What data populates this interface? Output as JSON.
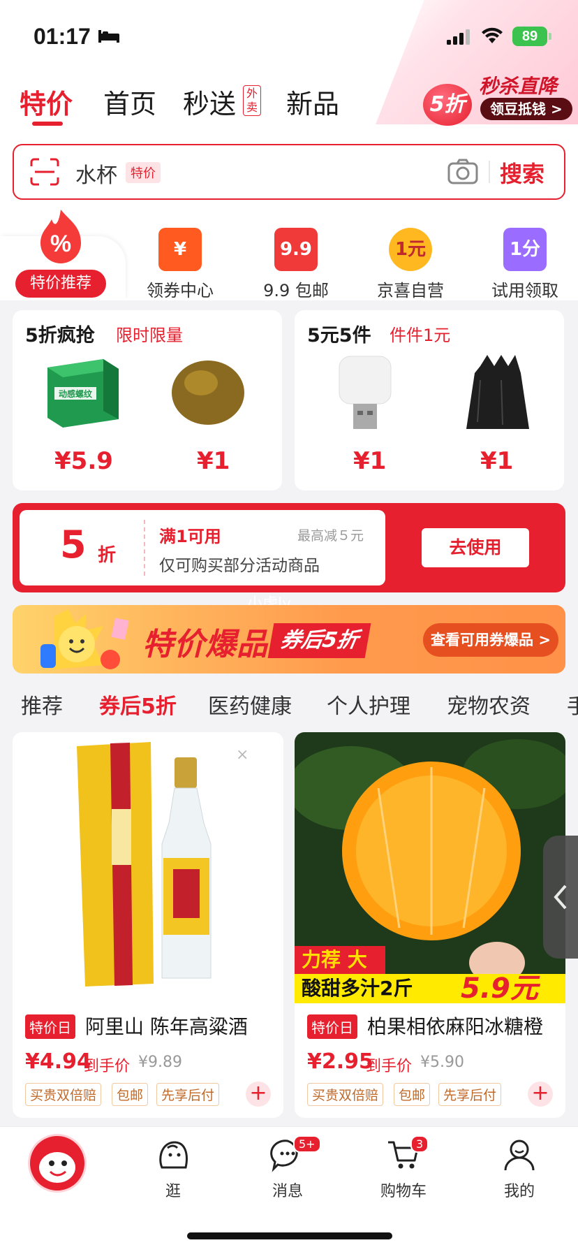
{
  "status": {
    "time": "01:17",
    "battery": "89"
  },
  "nav": {
    "tabs": [
      "特价",
      "首页",
      "秒送",
      "新品"
    ],
    "waimai": "外卖"
  },
  "flash": {
    "badge": "5折",
    "title": "秒杀直降",
    "button": "领豆抵钱 >"
  },
  "search": {
    "query": "水杯",
    "tag": "特价",
    "button": "搜索"
  },
  "categories": [
    {
      "label": "特价推荐",
      "icon": "fire-percent-icon",
      "active": true
    },
    {
      "label": "领券中心",
      "icon": "coupon-yen-icon",
      "glyph": "¥",
      "color": "#ff5a1f"
    },
    {
      "label": "9.9 包邮",
      "icon": "gift-box-icon",
      "glyph": "9.9",
      "color": "#f03a3a"
    },
    {
      "label": "京喜自营",
      "icon": "one-yuan-icon",
      "glyph": "1元",
      "color": "#ffb81f"
    },
    {
      "label": "试用领取",
      "icon": "shopping-bag-icon",
      "glyph": "1分",
      "color": "#9a6cff"
    }
  ],
  "deals": [
    {
      "title": "5折疯抢",
      "sub": "限时限量",
      "items": [
        {
          "price": "¥5.9",
          "img": "box-product-image"
        },
        {
          "price": "¥1",
          "img": "luohanguo-image"
        }
      ]
    },
    {
      "title": "5元5件",
      "sub": "件件1元",
      "items": [
        {
          "price": "¥1",
          "img": "usb-lamp-image"
        },
        {
          "price": "¥1",
          "img": "trash-bag-image"
        }
      ]
    }
  ],
  "coupon": {
    "discount": "5",
    "unit": "折",
    "condition": "满1可用",
    "max": "最高减５元",
    "desc": "仅可购买部分活动商品",
    "button": "去使用"
  },
  "watermark": "小虎ly",
  "banner": {
    "title": "特价爆品",
    "tag": "券后5折",
    "button": "查看可用券爆品 >"
  },
  "cat_tabs": [
    "推荐",
    "券后5折",
    "医药健康",
    "个人护理",
    "宠物农资",
    "手"
  ],
  "products": [
    {
      "tag": "特价日",
      "name": "阿里山 陈年高粱酒",
      "price": "¥4.94",
      "final": "到手价",
      "orig": "¥9.89",
      "badges": [
        "买贵双倍赔",
        "包邮",
        "先享后付"
      ]
    },
    {
      "tag": "特价日",
      "name": "柏果相依麻阳冰糖橙",
      "price": "¥2.95",
      "final": "到手价",
      "orig": "¥5.90",
      "badges": [
        "买贵双倍赔",
        "包邮",
        "先享后付"
      ],
      "overlay1": "力荐 大果",
      "overlay2": "酸甜多汁2斤",
      "overlay_price": "5.9元"
    }
  ],
  "bottom_nav": [
    {
      "label": "",
      "icon": "jd-mascot-icon"
    },
    {
      "label": "逛",
      "icon": "browse-icon"
    },
    {
      "label": "消息",
      "icon": "message-icon",
      "badge": "5+"
    },
    {
      "label": "购物车",
      "icon": "cart-icon",
      "badge": "3"
    },
    {
      "label": "我的",
      "icon": "profile-icon"
    }
  ],
  "colors": {
    "accent": "#e6202e",
    "bg": "#f3f3f5"
  }
}
